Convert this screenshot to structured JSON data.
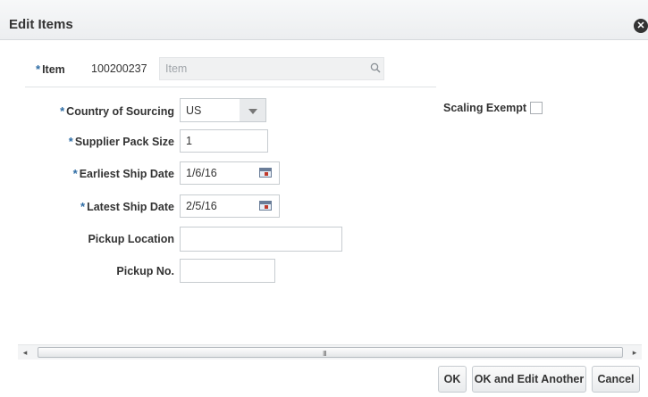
{
  "dialog": {
    "title": "Edit Items",
    "close_icon": "close-circle-icon"
  },
  "form": {
    "required_marker": "*",
    "item": {
      "label": "Item",
      "value": "100200237",
      "description_placeholder": "Item",
      "search_icon": "search-icon"
    },
    "country_of_sourcing": {
      "label": "Country of Sourcing",
      "value": "US"
    },
    "supplier_pack_size": {
      "label": "Supplier Pack Size",
      "value": "1"
    },
    "earliest_ship_date": {
      "label": "Earliest Ship Date",
      "value": "1/6/16",
      "icon": "calendar-icon"
    },
    "latest_ship_date": {
      "label": "Latest Ship Date",
      "value": "2/5/16",
      "icon": "calendar-icon"
    },
    "pickup_location": {
      "label": "Pickup Location",
      "value": ""
    },
    "pickup_no": {
      "label": "Pickup No.",
      "value": ""
    },
    "scaling_exempt": {
      "label": "Scaling Exempt",
      "checked": false
    }
  },
  "scrollbar": {
    "grip": "III"
  },
  "buttons": {
    "ok": "OK",
    "ok_and_edit_another": "OK and Edit Another",
    "cancel": "Cancel"
  }
}
